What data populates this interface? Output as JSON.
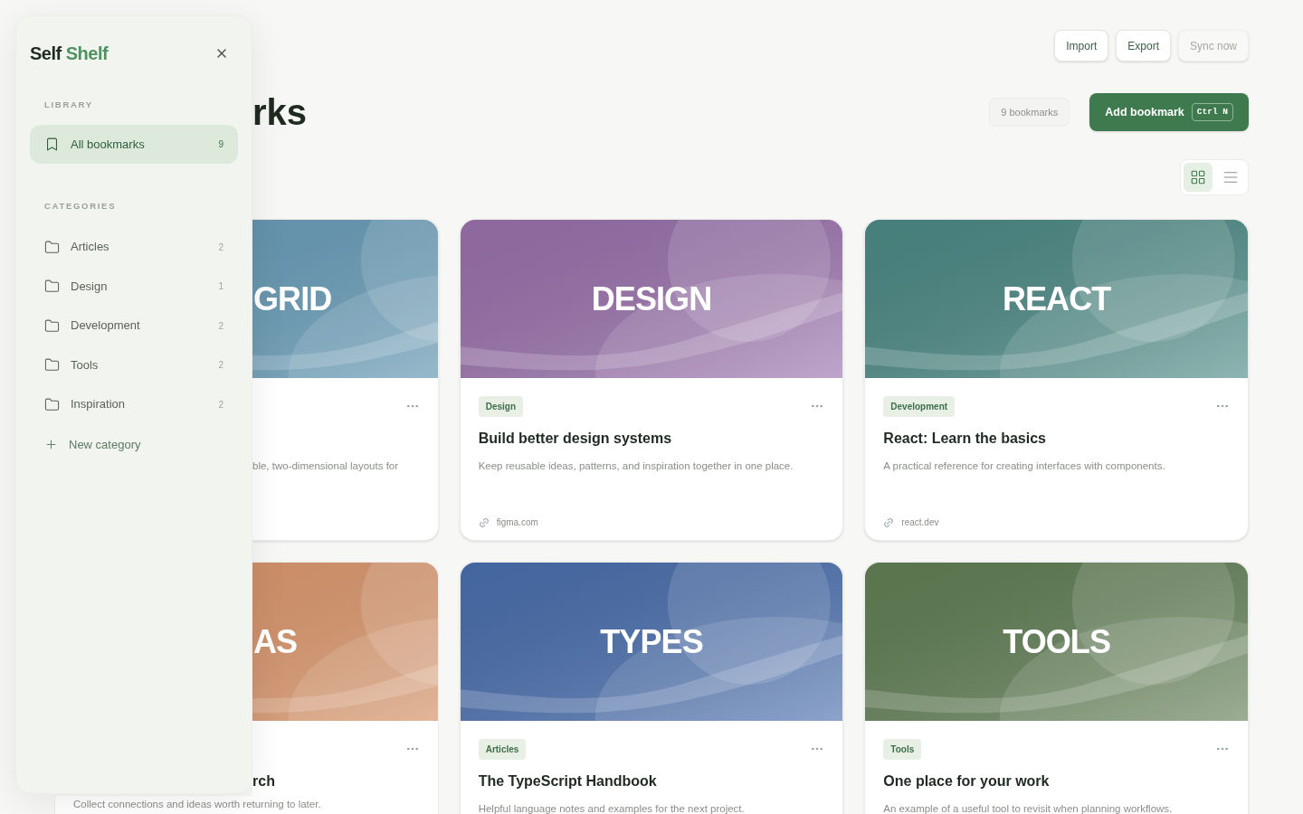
{
  "sidebar": {
    "logo": {
      "first": "Self",
      "second": "Shelf"
    },
    "library_heading": "LIBRARY",
    "library_items": [
      {
        "label": "All bookmarks",
        "count": "9",
        "selected": true
      }
    ],
    "categories_heading": "CATEGORIES",
    "categories": [
      {
        "label": "Articles",
        "count": "2",
        "selected": false
      },
      {
        "label": "Design",
        "count": "1",
        "selected": false
      },
      {
        "label": "Development",
        "count": "2",
        "selected": false
      },
      {
        "label": "Tools",
        "count": "2",
        "selected": false
      },
      {
        "label": "Inspiration",
        "count": "2",
        "selected": false
      }
    ],
    "new_category": "New category"
  },
  "toolbar": [
    {
      "label": "Import",
      "disabled": false
    },
    {
      "label": "Export",
      "disabled": false
    },
    {
      "label": "Sync now",
      "disabled": true
    }
  ],
  "page_title": "rks",
  "count_badge": "9 bookmarks",
  "add_button": {
    "label": "Add bookmark",
    "shortcut": "Ctrl N"
  },
  "view_toggle": [
    {
      "kind": "grid",
      "selected": true
    },
    {
      "kind": "list",
      "selected": false
    }
  ],
  "cards": [
    {
      "kind": "covered-top",
      "color": "#6a9fbb",
      "cover_text": "GRID",
      "description": "ble, two-dimensional layouts for"
    },
    {
      "kind": "full",
      "color": "#9a72ad",
      "cover_text": "DESIGN",
      "tag": "Design",
      "title": "Build better design systems",
      "description": "Keep reusable ideas, patterns, and inspiration together in one place.",
      "link": "figma.com"
    },
    {
      "kind": "full",
      "color": "#4c8a86",
      "cover_text": "REACT",
      "tag": "Development",
      "title": "React: Learn the basics",
      "description": "A practical reference for creating interfaces with components.",
      "link": "react.dev"
    },
    {
      "kind": "covered",
      "color": "#df9a6f",
      "cover_text": "AS",
      "title": "rch",
      "description": "Collect connections and ideas worth returning to later."
    },
    {
      "kind": "full",
      "color": "#4a6fae",
      "cover_text": "TYPES",
      "tag": "Articles",
      "title": "The TypeScript Handbook",
      "description": "Helpful language notes and examples for the next project."
    },
    {
      "kind": "full",
      "color": "#627f55",
      "cover_text": "TOOLS",
      "tag": "Tools",
      "title": "One place for your work",
      "description": "An example of a useful tool to revisit when planning workflows."
    }
  ]
}
